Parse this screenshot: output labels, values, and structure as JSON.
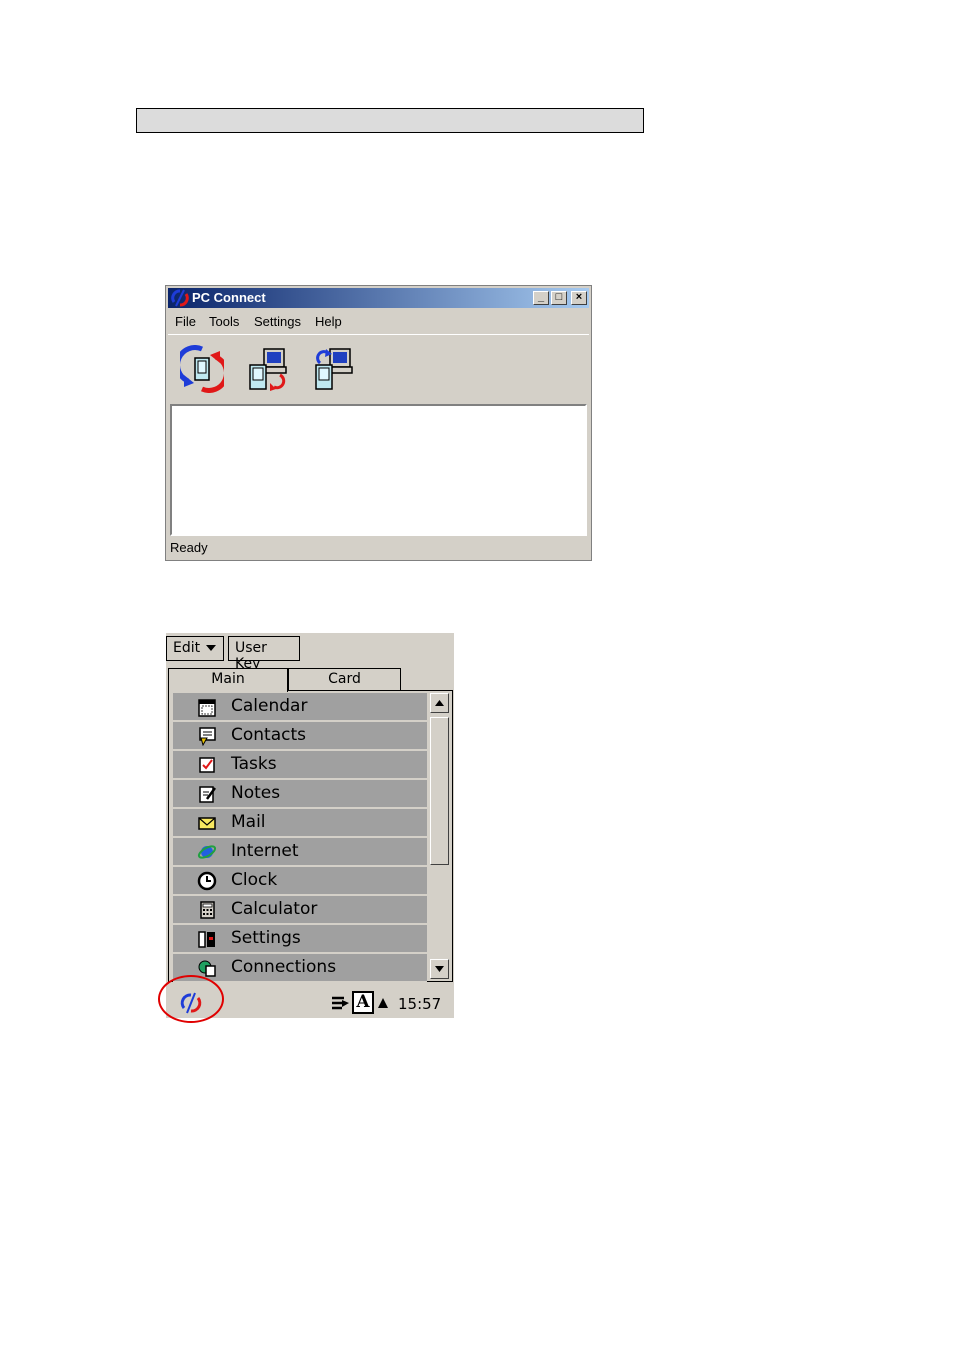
{
  "pc_window": {
    "title": "PC Connect",
    "menu": [
      "File",
      "Tools",
      "Settings",
      "Help"
    ],
    "toolbar_icons": [
      "sync-icon",
      "backup-icon",
      "restore-icon"
    ],
    "status": "Ready",
    "title_buttons": {
      "minimize": "_",
      "maximize": "□",
      "close": "×"
    }
  },
  "pda": {
    "commands": {
      "edit": "Edit",
      "user_key": "User Key"
    },
    "tabs": {
      "main": "Main",
      "card": "Card"
    },
    "items": [
      {
        "label": "Calendar",
        "icon": "calendar-icon"
      },
      {
        "label": "Contacts",
        "icon": "contacts-icon"
      },
      {
        "label": "Tasks",
        "icon": "tasks-icon"
      },
      {
        "label": "Notes",
        "icon": "notes-icon"
      },
      {
        "label": "Mail",
        "icon": "mail-icon"
      },
      {
        "label": "Internet",
        "icon": "internet-icon"
      },
      {
        "label": "Clock",
        "icon": "clock-icon"
      },
      {
        "label": "Calculator",
        "icon": "calculator-icon"
      },
      {
        "label": "Settings",
        "icon": "settings-icon"
      },
      {
        "label": "Connections",
        "icon": "connections-icon"
      }
    ],
    "taskbar": {
      "time": "15:57",
      "ime_label": "A"
    }
  },
  "colors": {
    "highlight": "#e00000",
    "sync_blue": "#1e3cd8",
    "sync_red": "#e01818"
  }
}
